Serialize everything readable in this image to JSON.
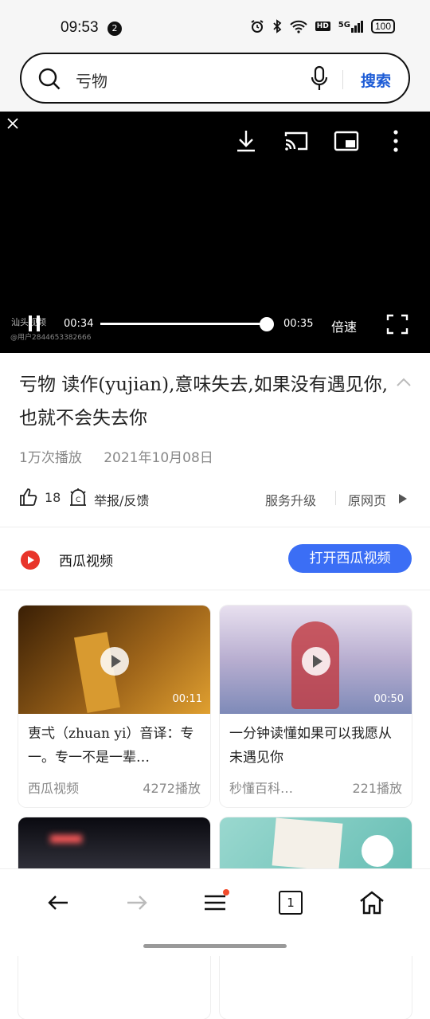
{
  "status": {
    "time": "09:53",
    "notif_count": "2",
    "net": "5G",
    "hd": "HD",
    "battery": "100"
  },
  "search": {
    "query": "亏物",
    "button": "搜索"
  },
  "player": {
    "watermark": "汕头视频",
    "user": "@用户2844653382666",
    "current": "00:34",
    "total": "00:35",
    "speed": "倍速",
    "progress": 0.97
  },
  "video": {
    "title": "亏物 读作(yujian),意味失去,如果没有遇见你,也就不会失去你",
    "views": "1万次播放",
    "date": "2021年10月08日",
    "likes": "18",
    "report": "举报/反馈",
    "upgrade": "服务升级",
    "original": "原网页"
  },
  "source": {
    "name": "西瓜视频",
    "open": "打开西瓜视频"
  },
  "cards": [
    {
      "title": "叀弌（zhuan yi）音译：专一。专一不是一辈…",
      "src": "西瓜视频",
      "plays": "4272播放",
      "dur": "00:11",
      "thumb_color": "#7a4a10"
    },
    {
      "title": "一分钟读懂如果可以我愿从未遇见你",
      "src": "秒懂百科…",
      "plays": "221播放",
      "dur": "00:50",
      "thumb_color": "#a9a3c7"
    },
    {
      "title": "",
      "src": "",
      "plays": "",
      "dur": "",
      "thumb_color": "#2a2a30"
    },
    {
      "title": "",
      "src": "",
      "plays": "",
      "dur": "",
      "thumb_color": "#7fc9c2"
    }
  ],
  "tabs": {
    "count": "1"
  }
}
